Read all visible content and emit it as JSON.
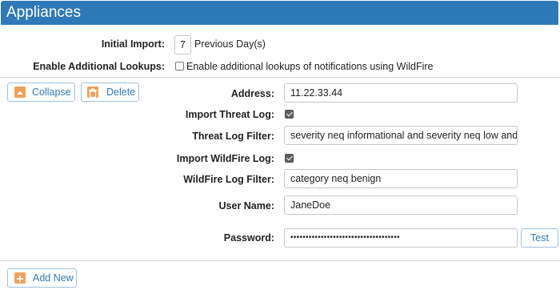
{
  "header": {
    "title": "Appliances"
  },
  "settings": {
    "initial_import_label": "Initial Import:",
    "initial_import_value": "7",
    "initial_import_unit": "Previous Day(s)",
    "additional_lookups_label": "Enable Additional Lookups:",
    "additional_lookups_checkbox_text": "Enable additional lookups of notifications using WildFire",
    "additional_lookups_checked": false
  },
  "actions": {
    "collapse_label": "Collapse",
    "delete_label": "Delete",
    "add_new_label": "Add New",
    "test_label": "Test"
  },
  "appliance": {
    "address_label": "Address:",
    "address_value": "11.22.33.44",
    "import_threat_log_label": "Import Threat Log:",
    "import_threat_log_checked": true,
    "threat_log_filter_label": "Threat Log Filter:",
    "threat_log_filter_value": "severity neq informational and severity neq low and se",
    "import_wildfire_log_label": "Import WildFire Log:",
    "import_wildfire_log_checked": true,
    "wildfire_log_filter_label": "WildFire Log Filter:",
    "wildfire_log_filter_value": "category neq benign",
    "user_name_label": "User Name:",
    "user_name_value": "JaneDoe",
    "password_label": "Password:",
    "password_value": "••••••••••••••••••••••••••••••••••••"
  },
  "colors": {
    "header_bg": "#2f79b8",
    "button_text": "#2f79b8",
    "icon_orange": "#f0a15a"
  }
}
